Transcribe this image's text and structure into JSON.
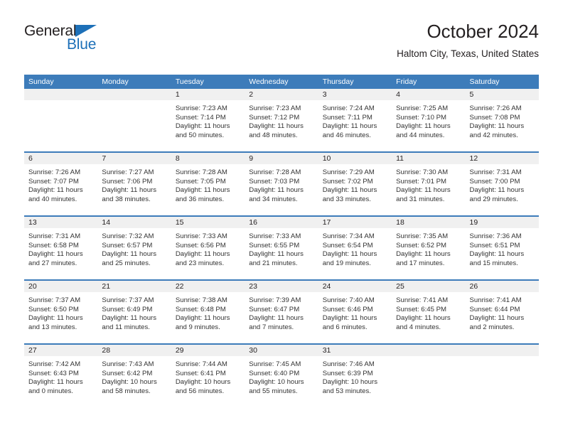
{
  "brand": {
    "name_part1": "General",
    "name_part2": "Blue",
    "accent_color": "#1d70b8"
  },
  "header": {
    "title": "October 2024",
    "subtitle": "Haltom City, Texas, United States"
  },
  "theme": {
    "header_bar_color": "#3d7cba",
    "day_number_band": "#f0f0f0",
    "text_color": "#231f20"
  },
  "weekdays": [
    "Sunday",
    "Monday",
    "Tuesday",
    "Wednesday",
    "Thursday",
    "Friday",
    "Saturday"
  ],
  "labels": {
    "sunrise_prefix": "Sunrise:",
    "sunset_prefix": "Sunset:",
    "daylight_prefix": "Daylight:"
  },
  "weeks": [
    [
      {
        "day": "",
        "empty": true
      },
      {
        "day": "",
        "empty": true
      },
      {
        "day": "1",
        "sunrise": "Sunrise: 7:23 AM",
        "sunset": "Sunset: 7:14 PM",
        "daylight_1": "Daylight: 11 hours",
        "daylight_2": "and 50 minutes."
      },
      {
        "day": "2",
        "sunrise": "Sunrise: 7:23 AM",
        "sunset": "Sunset: 7:12 PM",
        "daylight_1": "Daylight: 11 hours",
        "daylight_2": "and 48 minutes."
      },
      {
        "day": "3",
        "sunrise": "Sunrise: 7:24 AM",
        "sunset": "Sunset: 7:11 PM",
        "daylight_1": "Daylight: 11 hours",
        "daylight_2": "and 46 minutes."
      },
      {
        "day": "4",
        "sunrise": "Sunrise: 7:25 AM",
        "sunset": "Sunset: 7:10 PM",
        "daylight_1": "Daylight: 11 hours",
        "daylight_2": "and 44 minutes."
      },
      {
        "day": "5",
        "sunrise": "Sunrise: 7:26 AM",
        "sunset": "Sunset: 7:08 PM",
        "daylight_1": "Daylight: 11 hours",
        "daylight_2": "and 42 minutes."
      }
    ],
    [
      {
        "day": "6",
        "sunrise": "Sunrise: 7:26 AM",
        "sunset": "Sunset: 7:07 PM",
        "daylight_1": "Daylight: 11 hours",
        "daylight_2": "and 40 minutes."
      },
      {
        "day": "7",
        "sunrise": "Sunrise: 7:27 AM",
        "sunset": "Sunset: 7:06 PM",
        "daylight_1": "Daylight: 11 hours",
        "daylight_2": "and 38 minutes."
      },
      {
        "day": "8",
        "sunrise": "Sunrise: 7:28 AM",
        "sunset": "Sunset: 7:05 PM",
        "daylight_1": "Daylight: 11 hours",
        "daylight_2": "and 36 minutes."
      },
      {
        "day": "9",
        "sunrise": "Sunrise: 7:28 AM",
        "sunset": "Sunset: 7:03 PM",
        "daylight_1": "Daylight: 11 hours",
        "daylight_2": "and 34 minutes."
      },
      {
        "day": "10",
        "sunrise": "Sunrise: 7:29 AM",
        "sunset": "Sunset: 7:02 PM",
        "daylight_1": "Daylight: 11 hours",
        "daylight_2": "and 33 minutes."
      },
      {
        "day": "11",
        "sunrise": "Sunrise: 7:30 AM",
        "sunset": "Sunset: 7:01 PM",
        "daylight_1": "Daylight: 11 hours",
        "daylight_2": "and 31 minutes."
      },
      {
        "day": "12",
        "sunrise": "Sunrise: 7:31 AM",
        "sunset": "Sunset: 7:00 PM",
        "daylight_1": "Daylight: 11 hours",
        "daylight_2": "and 29 minutes."
      }
    ],
    [
      {
        "day": "13",
        "sunrise": "Sunrise: 7:31 AM",
        "sunset": "Sunset: 6:58 PM",
        "daylight_1": "Daylight: 11 hours",
        "daylight_2": "and 27 minutes."
      },
      {
        "day": "14",
        "sunrise": "Sunrise: 7:32 AM",
        "sunset": "Sunset: 6:57 PM",
        "daylight_1": "Daylight: 11 hours",
        "daylight_2": "and 25 minutes."
      },
      {
        "day": "15",
        "sunrise": "Sunrise: 7:33 AM",
        "sunset": "Sunset: 6:56 PM",
        "daylight_1": "Daylight: 11 hours",
        "daylight_2": "and 23 minutes."
      },
      {
        "day": "16",
        "sunrise": "Sunrise: 7:33 AM",
        "sunset": "Sunset: 6:55 PM",
        "daylight_1": "Daylight: 11 hours",
        "daylight_2": "and 21 minutes."
      },
      {
        "day": "17",
        "sunrise": "Sunrise: 7:34 AM",
        "sunset": "Sunset: 6:54 PM",
        "daylight_1": "Daylight: 11 hours",
        "daylight_2": "and 19 minutes."
      },
      {
        "day": "18",
        "sunrise": "Sunrise: 7:35 AM",
        "sunset": "Sunset: 6:52 PM",
        "daylight_1": "Daylight: 11 hours",
        "daylight_2": "and 17 minutes."
      },
      {
        "day": "19",
        "sunrise": "Sunrise: 7:36 AM",
        "sunset": "Sunset: 6:51 PM",
        "daylight_1": "Daylight: 11 hours",
        "daylight_2": "and 15 minutes."
      }
    ],
    [
      {
        "day": "20",
        "sunrise": "Sunrise: 7:37 AM",
        "sunset": "Sunset: 6:50 PM",
        "daylight_1": "Daylight: 11 hours",
        "daylight_2": "and 13 minutes."
      },
      {
        "day": "21",
        "sunrise": "Sunrise: 7:37 AM",
        "sunset": "Sunset: 6:49 PM",
        "daylight_1": "Daylight: 11 hours",
        "daylight_2": "and 11 minutes."
      },
      {
        "day": "22",
        "sunrise": "Sunrise: 7:38 AM",
        "sunset": "Sunset: 6:48 PM",
        "daylight_1": "Daylight: 11 hours",
        "daylight_2": "and 9 minutes."
      },
      {
        "day": "23",
        "sunrise": "Sunrise: 7:39 AM",
        "sunset": "Sunset: 6:47 PM",
        "daylight_1": "Daylight: 11 hours",
        "daylight_2": "and 7 minutes."
      },
      {
        "day": "24",
        "sunrise": "Sunrise: 7:40 AM",
        "sunset": "Sunset: 6:46 PM",
        "daylight_1": "Daylight: 11 hours",
        "daylight_2": "and 6 minutes."
      },
      {
        "day": "25",
        "sunrise": "Sunrise: 7:41 AM",
        "sunset": "Sunset: 6:45 PM",
        "daylight_1": "Daylight: 11 hours",
        "daylight_2": "and 4 minutes."
      },
      {
        "day": "26",
        "sunrise": "Sunrise: 7:41 AM",
        "sunset": "Sunset: 6:44 PM",
        "daylight_1": "Daylight: 11 hours",
        "daylight_2": "and 2 minutes."
      }
    ],
    [
      {
        "day": "27",
        "sunrise": "Sunrise: 7:42 AM",
        "sunset": "Sunset: 6:43 PM",
        "daylight_1": "Daylight: 11 hours",
        "daylight_2": "and 0 minutes."
      },
      {
        "day": "28",
        "sunrise": "Sunrise: 7:43 AM",
        "sunset": "Sunset: 6:42 PM",
        "daylight_1": "Daylight: 10 hours",
        "daylight_2": "and 58 minutes."
      },
      {
        "day": "29",
        "sunrise": "Sunrise: 7:44 AM",
        "sunset": "Sunset: 6:41 PM",
        "daylight_1": "Daylight: 10 hours",
        "daylight_2": "and 56 minutes."
      },
      {
        "day": "30",
        "sunrise": "Sunrise: 7:45 AM",
        "sunset": "Sunset: 6:40 PM",
        "daylight_1": "Daylight: 10 hours",
        "daylight_2": "and 55 minutes."
      },
      {
        "day": "31",
        "sunrise": "Sunrise: 7:46 AM",
        "sunset": "Sunset: 6:39 PM",
        "daylight_1": "Daylight: 10 hours",
        "daylight_2": "and 53 minutes."
      },
      {
        "day": "",
        "empty": true
      },
      {
        "day": "",
        "empty": true
      }
    ]
  ]
}
